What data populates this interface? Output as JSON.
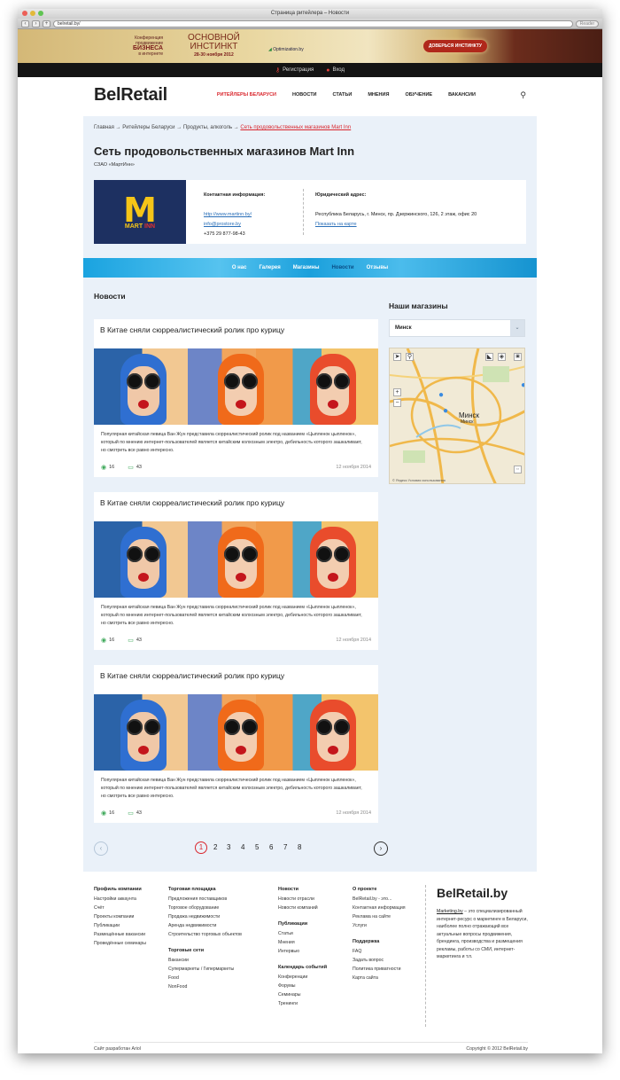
{
  "browser": {
    "window_title": "Страница ритейлера – Новости",
    "url": "belretail.by/",
    "reader_label": "Reader"
  },
  "banner": {
    "conf_line1": "Конференция",
    "conf_line2": "продвижение",
    "conf_line3": "БИЗНЕСА",
    "conf_line4": "в интернете",
    "main_line1": "ОСНОВНОЙ",
    "main_line2": "ИНСТИНКТ",
    "dates": "28-30 ноября 2012",
    "sponsor": "Optimization.by",
    "cta": "ДОВЕРЬСЯ ИНСТИНКТУ"
  },
  "topbar": {
    "register": "Регистрация",
    "login": "Вход"
  },
  "header": {
    "logo": "BelRetail",
    "nav": [
      "РИТЕЙЛЕРЫ БЕЛАРУСИ",
      "НОВОСТИ",
      "СТАТЬИ",
      "МНЕНИЯ",
      "ОБУЧЕНИЕ",
      "ВАКАНСИИ"
    ]
  },
  "breadcrumbs": {
    "items": [
      "Главная",
      "Ритейлеры Беларуси",
      "Продукты, алкоголь"
    ],
    "current": "Сеть продовольственных магазинов Mart Inn"
  },
  "company": {
    "title": "Сеть продовольственных магазинов Mart Inn",
    "subtitle": "СЗАО «МартИнн»",
    "logo_letter": "M",
    "logo_mart": "MART",
    "logo_inn": "INN",
    "contact_heading": "Контактная информация:",
    "website": "http://www.martinn.by/",
    "email": "info@prostore.by",
    "phone": "+375 29 877-98-43",
    "legal_heading": "Юридический адрес:",
    "address": "Республика Беларусь, г. Минск, пр. Дзержинского, 126, 2 этаж, офис 20",
    "map_link": "Показать на карте"
  },
  "tabs": [
    "О нас",
    "Галерея",
    "Магазины",
    "Новости",
    "Отзывы"
  ],
  "news": {
    "heading": "Новости",
    "posts": [
      {
        "title": "В Китае сняли сюрреалистический ролик про курицу",
        "text": "Популярная китайская певица Ван Жун представила сюрреалистический ролик под названием «Цыпленок цыпленок», который по мнению интернет-пользователей является китайским колхозным электро, дебильность которого зашкаливает, но смотреть все равно интересно.",
        "views": "16",
        "comments": "43",
        "date": "12 ноября 2014"
      },
      {
        "title": "В Китае сняли сюрреалистический ролик про курицу",
        "text": "Популярная китайская певица Ван Жун представила сюрреалистический ролик под названием «Цыпленок цыпленок», который по мнению интернет-пользователей является китайским колхозным электро, дебильность которого зашкаливает, но смотреть все равно интересно.",
        "views": "16",
        "comments": "43",
        "date": "12 ноября 2014"
      },
      {
        "title": "В Китае сняли сюрреалистический ролик про курицу",
        "text": "Популярная китайская певица Ван Жун представила сюрреалистический ролик под названием «Цыпленок цыпленок», который по мнению интернет-пользователей является китайским колхозным электро, дебильность которого зашкаливает, но смотреть все равно интересно.",
        "views": "16",
        "comments": "43",
        "date": "12 ноября 2014"
      }
    ]
  },
  "sidebar": {
    "heading": "Наши магазины",
    "city": "Минск",
    "map_city_label": "Минск",
    "map_city_label_small": "Минск",
    "map_copyright": "© Яндекс  Условия использования",
    "map_credit": "Работы по карте · Открыть карту"
  },
  "pagination": {
    "pages": [
      "1",
      "2",
      "3",
      "4",
      "5",
      "6",
      "7",
      "8"
    ],
    "current": "1"
  },
  "footer": {
    "col1": {
      "title": "Профиль компании",
      "items": [
        "Настройки аккаунта",
        "Счёт",
        "Проекты компании",
        "Публикации",
        "Размещённые вакансии",
        "Проведённые семинары"
      ]
    },
    "col2": {
      "title": "Торговая площадка",
      "items": [
        "Предложения поставщиков",
        "Торговое оборудование",
        "Продажа недвижимости",
        "Аренда недвижимости",
        "Строительство торговых объектов"
      ]
    },
    "col2b": {
      "title": "Торговые сети",
      "items": [
        "Вакансии",
        "Супермаркеты / Гипермаркеты",
        "Food",
        "NonFood"
      ]
    },
    "col3": {
      "title": "Новости",
      "items": [
        "Новости отрасли",
        "Новости компаний"
      ]
    },
    "col3b": {
      "title": "Публикации",
      "items": [
        "Статьи",
        "Мнения",
        "Интервью"
      ]
    },
    "col3c": {
      "title": "Календарь событий",
      "items": [
        "Конференции",
        "Форумы",
        "Семинары",
        "Тренинги"
      ]
    },
    "col4": {
      "title": "О проекте",
      "items": [
        "BelRetail.by - это...",
        "Контактная информация",
        "Реклама на сайте",
        "Услуги"
      ]
    },
    "col4b": {
      "title": "Поддержка",
      "items": [
        "FAQ",
        "Задать вопрос",
        "Политика приватности",
        "Карта сайта"
      ]
    },
    "logo": "BelRetail.by",
    "desc_brand": "Marketing.by",
    "desc": " – это специализированный интернет-ресурс о маркетинге в Беларуси, наиболее полно отражающий все актуальные вопросы продвижения, брендинга, производства и размещения рекламы, работы со СМИ, интернет-маркетинга и т.п.",
    "developer": "Сайт разработан Ariol",
    "copyright": "Copyright © 2012 BelRetail.by"
  },
  "colors": {
    "accent": "#d9262d",
    "link": "#2a6fb8",
    "tabs": "#1aa3e0",
    "icons": "#3fa95b"
  }
}
